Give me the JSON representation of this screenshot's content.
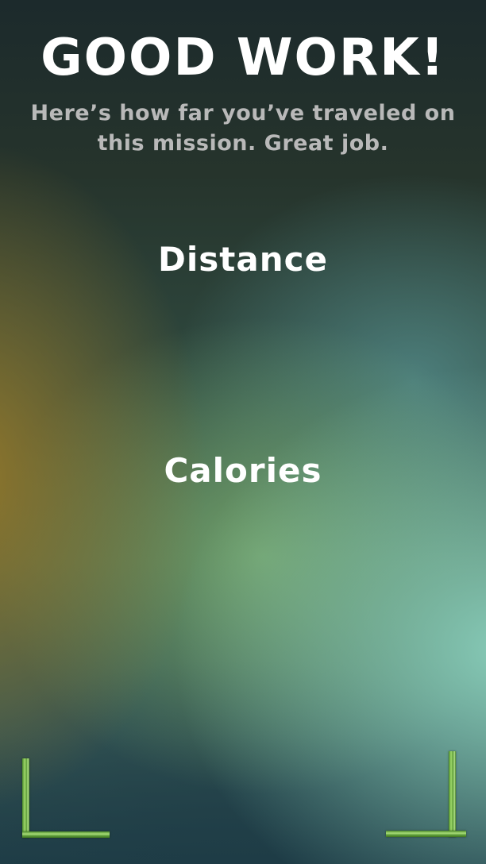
{
  "header": {
    "title": "GOOD WORK!",
    "subtitle": "Here’s how far you’ve traveled on this mission. Great job."
  },
  "stats": {
    "distance_label": "Distance",
    "calories_label": "Calories"
  },
  "decor": {
    "corner_color": "#8fcf5c"
  }
}
